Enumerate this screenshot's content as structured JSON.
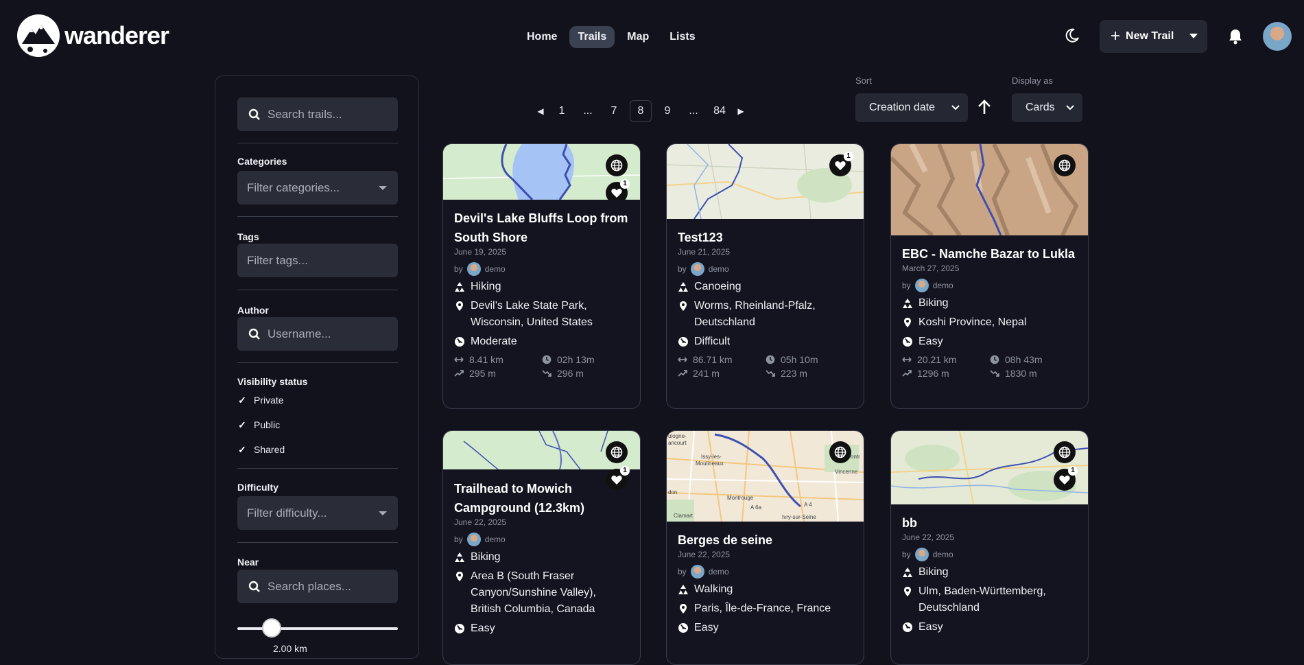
{
  "app": {
    "name": "wanderer"
  },
  "nav": [
    {
      "label": "Home"
    },
    {
      "label": "Trails",
      "active": true
    },
    {
      "label": "Map"
    },
    {
      "label": "Lists"
    }
  ],
  "header": {
    "new_trail_label": "New Trail"
  },
  "filters": {
    "search_placeholder": "Search trails...",
    "categories_label": "Categories",
    "categories_placeholder": "Filter categories...",
    "tags_label": "Tags",
    "tags_placeholder": "Filter tags...",
    "author_label": "Author",
    "author_placeholder": "Username...",
    "visibility_label": "Visibility status",
    "visibility": [
      {
        "label": "Private",
        "checked": true
      },
      {
        "label": "Public",
        "checked": true
      },
      {
        "label": "Shared",
        "checked": true
      }
    ],
    "difficulty_label": "Difficulty",
    "difficulty_placeholder": "Filter difficulty...",
    "near_label": "Near",
    "near_placeholder": "Search places...",
    "radius_value": "2.00 km"
  },
  "pagination": {
    "pages": [
      "1",
      "...",
      "7",
      "8",
      "9",
      "...",
      "84"
    ],
    "current": "8"
  },
  "sort": {
    "label": "Sort",
    "value": "Creation date",
    "direction": "ascending"
  },
  "display": {
    "label": "Display as",
    "value": "Cards"
  },
  "trails": [
    {
      "title": "Devil's Lake Bluffs Loop from South Shore",
      "date": "June 19, 2025",
      "author": "demo",
      "category": "Hiking",
      "location": "Devil’s Lake State Park, Wisconsin, United States",
      "difficulty": "Moderate",
      "distance": "8.41 km",
      "duration": "02h 13m",
      "elevation_gain": "295 m",
      "elevation_loss": "296 m",
      "likes": "1",
      "public": true
    },
    {
      "title": "Test123",
      "date": "June 21, 2025",
      "author": "demo",
      "category": "Canoeing",
      "location": "Worms, Rheinland-Pfalz, Deutschland",
      "difficulty": "Difficult",
      "distance": "86.71 km",
      "duration": "05h 10m",
      "elevation_gain": "241 m",
      "elevation_loss": "223 m",
      "likes": "1",
      "public": false
    },
    {
      "title": "EBC - Namche Bazar to Lukla",
      "date": "March 27, 2025",
      "author": "demo",
      "category": "Biking",
      "location": "Koshi Province, Nepal",
      "difficulty": "Easy",
      "distance": "20.21 km",
      "duration": "08h 43m",
      "elevation_gain": "1296 m",
      "elevation_loss": "1830 m",
      "likes": "",
      "public": true
    },
    {
      "title": "Trailhead to Mowich Campground (12.3km)",
      "date": "June 22, 2025",
      "author": "demo",
      "category": "Biking",
      "location": "Area B (South Fraser Canyon/Sunshine Valley), British Columbia, Canada",
      "difficulty": "Easy",
      "likes": "1",
      "public": true
    },
    {
      "title": "Berges de seine",
      "date": "June 22, 2025",
      "author": "demo",
      "category": "Walking",
      "location": "Paris, Île-de-France, France",
      "difficulty": "Easy",
      "likes": "",
      "public": true,
      "map_labels": [
        "ulogne-",
        "ancourt",
        "Issy-les-",
        "Moulineaux",
        "don",
        "Montrouge",
        "Ivry-sur-Seine",
        "Vincenne",
        "ontr",
        "Clamart",
        "A 6a",
        "A 4"
      ]
    },
    {
      "title": "bb",
      "date": "June 22, 2025",
      "author": "demo",
      "category": "Biking",
      "location": "Ulm, Baden-Württemberg, Deutschland",
      "difficulty": "Easy",
      "likes": "1",
      "public": true
    }
  ],
  "colors": {
    "background": "#12121c",
    "card": "#141420",
    "route": "#3d4fb0",
    "accent_button": "#252833"
  }
}
